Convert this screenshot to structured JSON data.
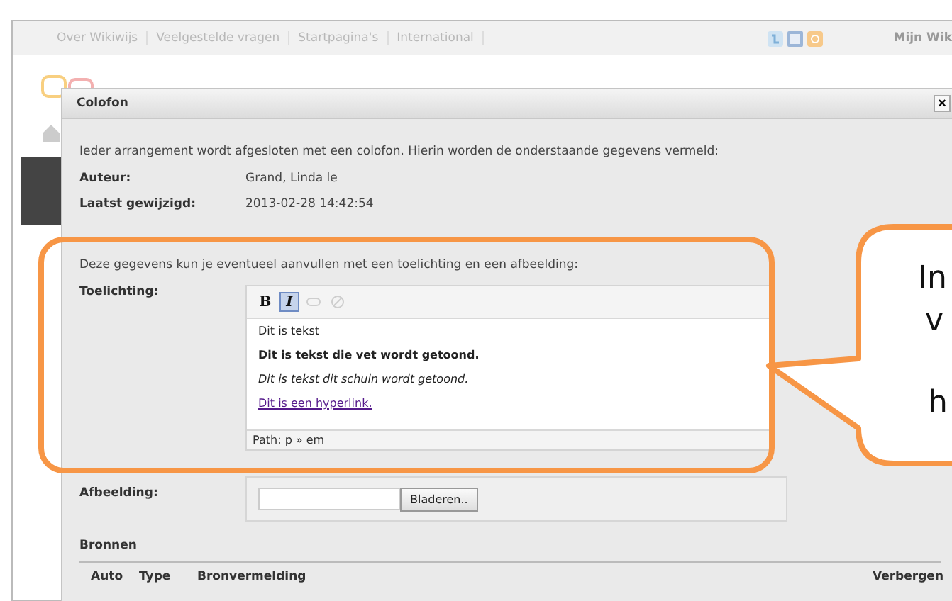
{
  "nav": {
    "links": [
      "Over Wikiwijs",
      "Veelgestelde vragen",
      "Startpagina's",
      "International"
    ],
    "account": "Mijn Wik"
  },
  "dialog": {
    "title": "Colofon",
    "close": "×",
    "intro": "Ieder arrangement wordt afgesloten met een colofon. Hierin worden de onderstaande gegevens vermeld:",
    "fields": [
      {
        "label": "Auteur:",
        "value": "Grand, Linda le"
      },
      {
        "label": "Laatst gewijzigd:",
        "value": "2013-02-28 14:42:54"
      }
    ],
    "note": "Deze gegevens kun je eventueel aanvullen met een toelichting en een afbeelding:",
    "editor": {
      "label": "Toelichting:",
      "toolbar": [
        {
          "kind": "bold",
          "label": "B",
          "selected": false,
          "disabled": false
        },
        {
          "kind": "italic",
          "label": "I",
          "selected": true,
          "disabled": false
        },
        {
          "kind": "link",
          "selected": false,
          "disabled": true
        },
        {
          "kind": "unlink",
          "selected": false,
          "disabled": true
        }
      ],
      "paragraphs": [
        {
          "kind": "plain",
          "text": "Dit is tekst"
        },
        {
          "kind": "bold",
          "text": "Dit is tekst die vet wordt getoond."
        },
        {
          "kind": "italic",
          "text": "Dit is tekst dit schuin wordt getoond."
        },
        {
          "kind": "link",
          "text": "Dit is een hyperlink."
        }
      ],
      "path": "Path: p » em"
    },
    "image": {
      "label": "Afbeelding:",
      "button": "Bladeren.."
    },
    "sources": {
      "title": "Bronnen",
      "columns": [
        "Auto",
        "Type",
        "Bronvermelding",
        "Verbergen"
      ]
    }
  },
  "callout": {
    "lines": [
      "In",
      "v",
      "h"
    ]
  }
}
